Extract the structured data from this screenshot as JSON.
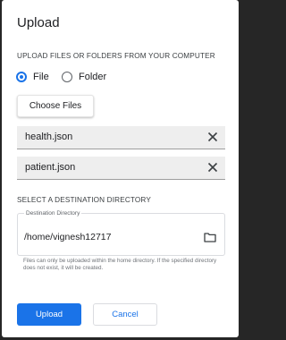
{
  "dialog": {
    "title": "Upload",
    "source_heading": "UPLOAD FILES OR FOLDERS FROM YOUR COMPUTER",
    "radio": {
      "file_label": "File",
      "folder_label": "Folder",
      "selected": "File"
    },
    "choose_button": "Choose Files",
    "files": [
      {
        "name": "health.json",
        "icon": "close-icon"
      },
      {
        "name": "patient.json",
        "icon": "close-icon"
      }
    ],
    "destination_heading": "SELECT A DESTINATION DIRECTORY",
    "destination": {
      "label": "Destination Directory",
      "value": "/home/vignesh12717",
      "icon": "folder-icon",
      "hint": "Files can only be uploaded within the home directory. If the specified directory does not exist, it will be created."
    },
    "upload_button": "Upload",
    "cancel_button": "Cancel"
  },
  "colors": {
    "accent": "#1a73e8",
    "backdrop": "#262626",
    "file_row_bg": "#eeeeee"
  }
}
